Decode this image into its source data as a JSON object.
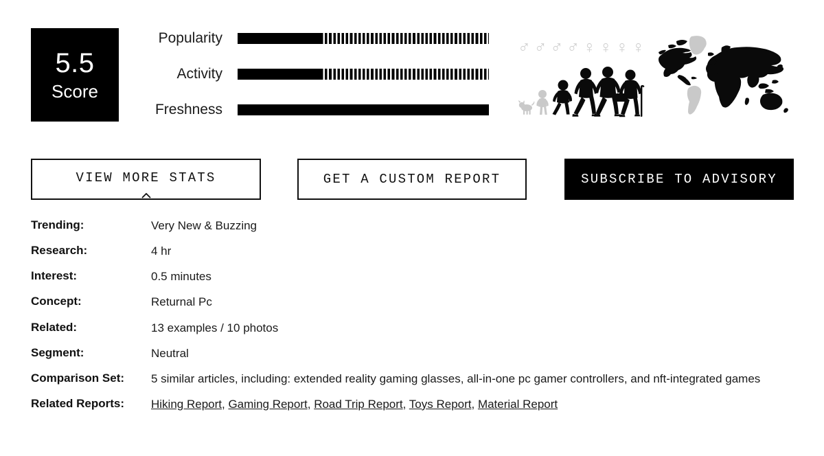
{
  "score": {
    "value": "5.5",
    "caption": "Score"
  },
  "metrics": [
    {
      "label": "Popularity",
      "filled_pct": 33,
      "style": "partial"
    },
    {
      "label": "Activity",
      "filled_pct": 33,
      "style": "partial"
    },
    {
      "label": "Freshness",
      "filled_pct": 100,
      "style": "full"
    }
  ],
  "chart_data": {
    "type": "bar",
    "title": "",
    "categories": [
      "Popularity",
      "Activity",
      "Freshness"
    ],
    "values": [
      33,
      33,
      100
    ],
    "xlabel": "",
    "ylabel": "",
    "xlim": [
      0,
      100
    ],
    "grid": false,
    "notes": "Horizontal progress bars; solid black = achieved portion, striped = remaining portion"
  },
  "demographics": {
    "male_symbol": "♂",
    "female_symbol": "♀",
    "male_count": 4,
    "female_count": 4,
    "age_figure_label": "age-progression-silhouettes"
  },
  "map": {
    "label": "world-map",
    "active_color": "#000000",
    "inactive_color": "#c9c9c9"
  },
  "buttons": {
    "view_more_stats": "VIEW MORE STATS",
    "get_custom_report": "GET A CUSTOM REPORT",
    "subscribe_advisory": "SUBSCRIBE TO ADVISORY"
  },
  "details": [
    {
      "label": "Trending:",
      "value": "Very New & Buzzing"
    },
    {
      "label": "Research:",
      "value": "4 hr"
    },
    {
      "label": "Interest:",
      "value": "0.5 minutes"
    },
    {
      "label": "Concept:",
      "value": "Returnal Pc"
    },
    {
      "label": "Related:",
      "value": "13 examples / 10 photos"
    },
    {
      "label": "Segment:",
      "value": "Neutral"
    },
    {
      "label": "Comparison Set:",
      "value": "5 similar articles, including: extended reality gaming glasses, all-in-one pc gamer controllers, and nft-integrated games"
    }
  ],
  "related_reports": {
    "label": "Related Reports:",
    "links": [
      "Hiking Report",
      "Gaming Report",
      "Road Trip Report",
      "Toys Report",
      "Material Report"
    ],
    "separator": ", "
  },
  "colors": {
    "ink": "#000000",
    "text": "#1a1a1a",
    "muted": "#cfcfcf",
    "background": "#ffffff"
  }
}
